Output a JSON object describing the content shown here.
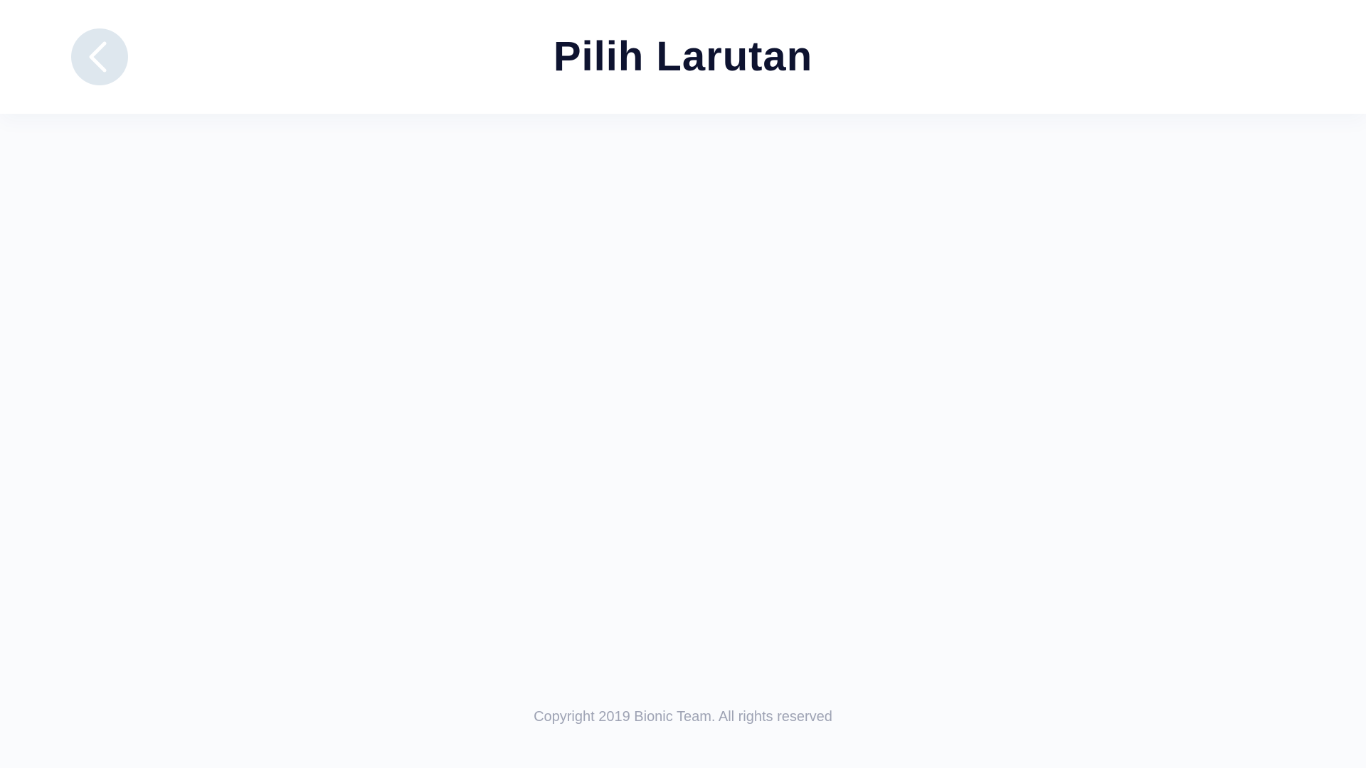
{
  "header": {
    "title": "Pilih Larutan",
    "back_icon": "chevron-left-icon",
    "back_button_color": "#dee7ee",
    "title_color": "#0e1330"
  },
  "footer": {
    "copyright": "Copyright 2019 Bionic Team.  All rights reserved",
    "text_color": "#9ea3b4"
  },
  "colors": {
    "page_background": "#fafbfd",
    "header_background": "#ffffff"
  }
}
